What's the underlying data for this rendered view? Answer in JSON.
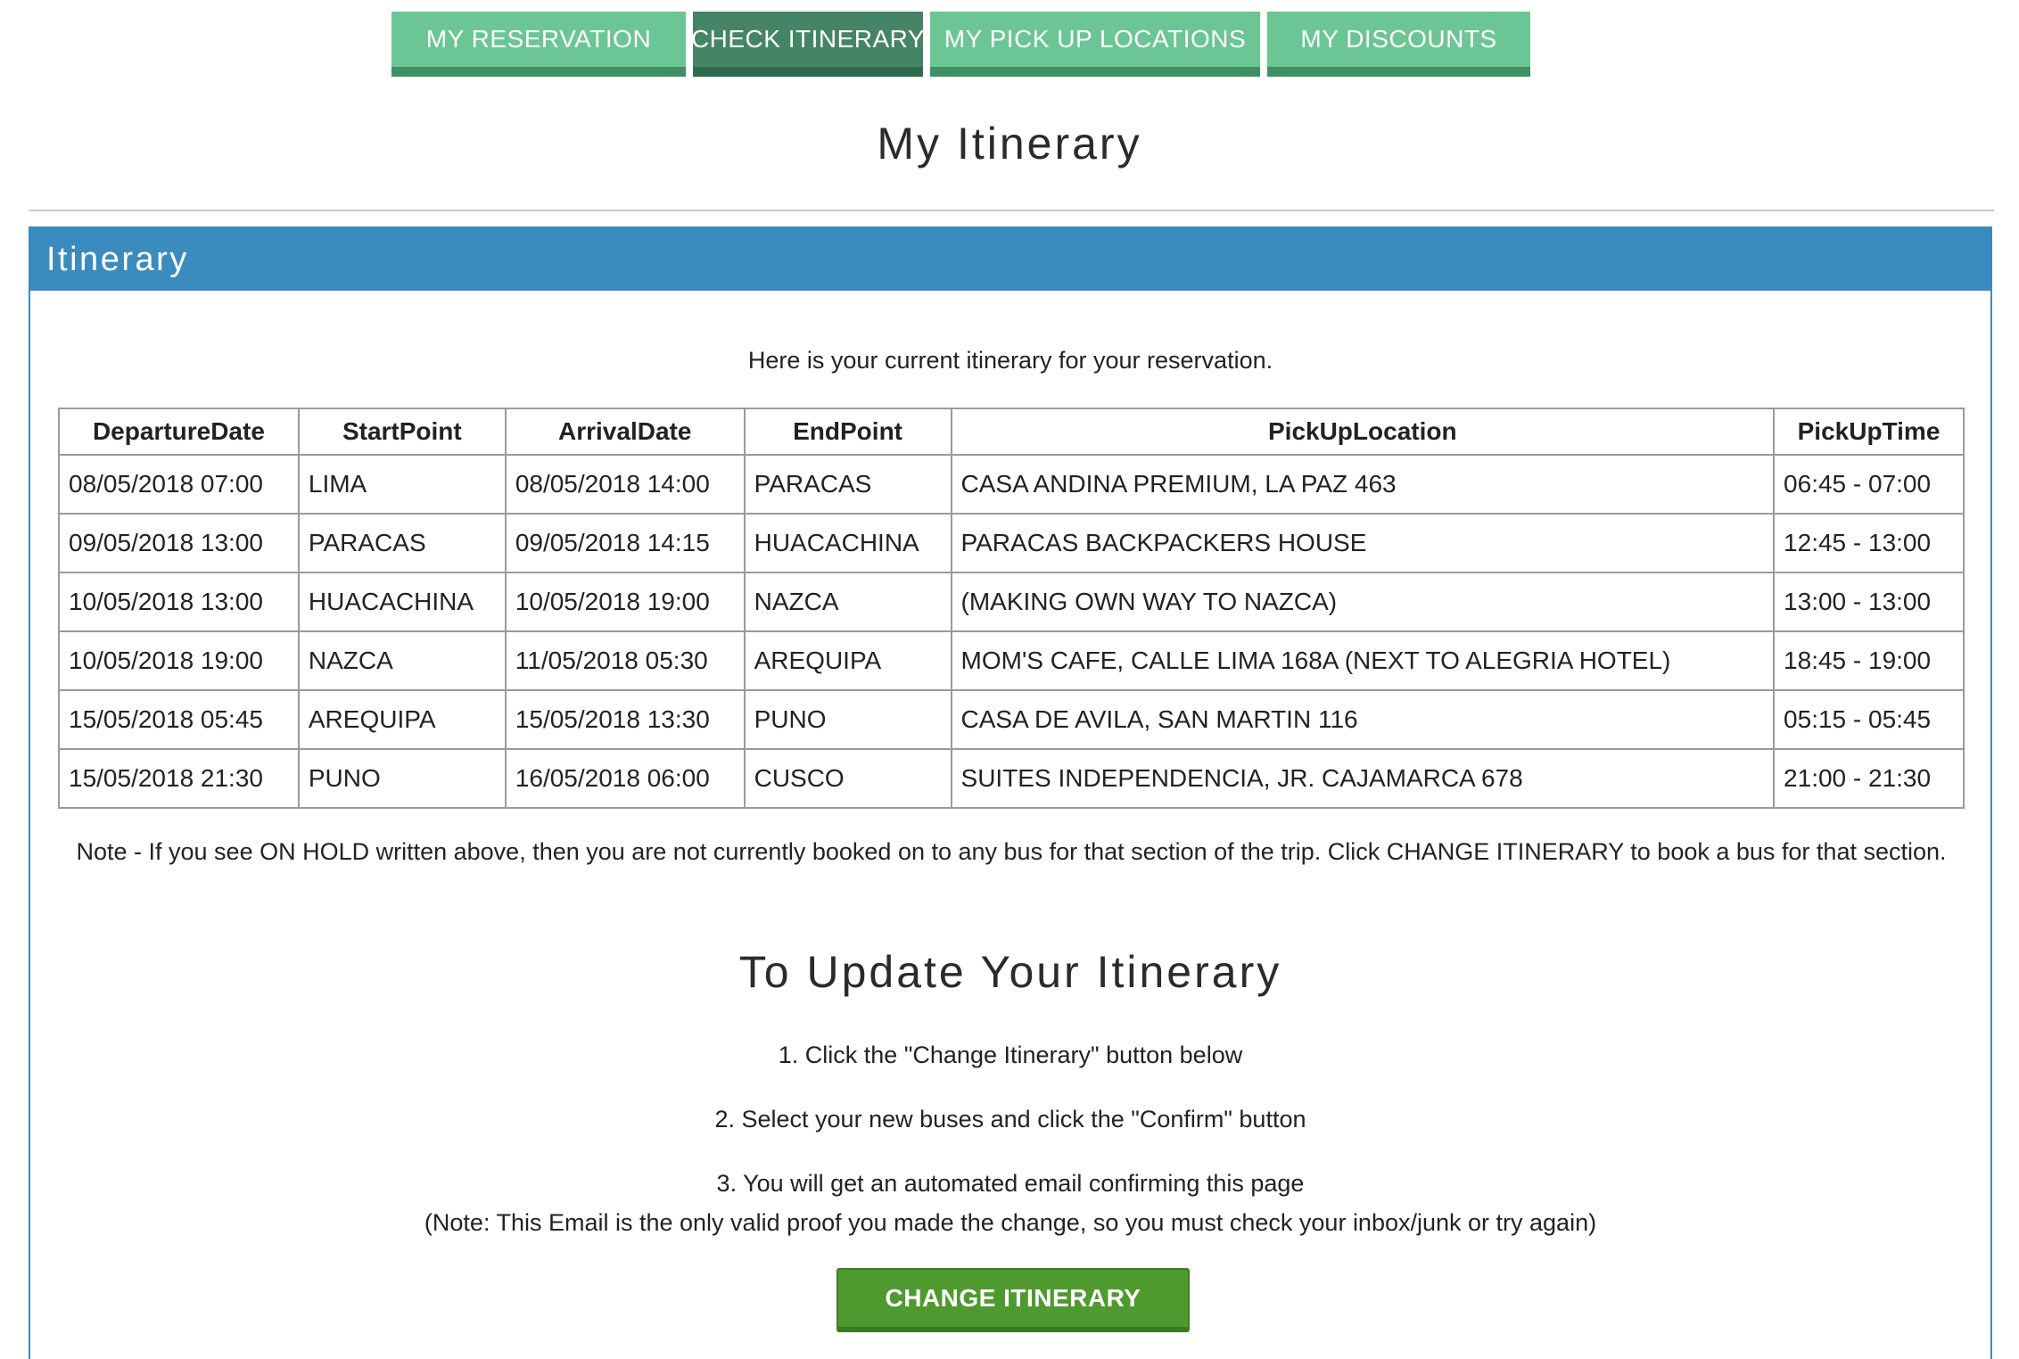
{
  "tabs": [
    {
      "label": "MY RESERVATION"
    },
    {
      "label": "CHECK ITINERARY"
    },
    {
      "label": "MY PICK UP LOCATIONS"
    },
    {
      "label": "MY DISCOUNTS"
    }
  ],
  "page_title": "My Itinerary",
  "panel": {
    "title": "Itinerary",
    "intro": "Here is your current itinerary for your reservation.",
    "columns": [
      "DepartureDate",
      "StartPoint",
      "ArrivalDate",
      "EndPoint",
      "PickUpLocation",
      "PickUpTime"
    ],
    "rows": [
      [
        "08/05/2018 07:00",
        "LIMA",
        "08/05/2018 14:00",
        "PARACAS",
        "CASA ANDINA PREMIUM, LA PAZ 463",
        "06:45 - 07:00"
      ],
      [
        "09/05/2018 13:00",
        "PARACAS",
        "09/05/2018 14:15",
        "HUACACHINA",
        "PARACAS BACKPACKERS HOUSE",
        "12:45 - 13:00"
      ],
      [
        "10/05/2018 13:00",
        "HUACACHINA",
        "10/05/2018 19:00",
        "NAZCA",
        "(MAKING OWN WAY TO NAZCA)",
        "13:00 - 13:00"
      ],
      [
        "10/05/2018 19:00",
        "NAZCA",
        "11/05/2018 05:30",
        "AREQUIPA",
        "MOM'S CAFE, CALLE LIMA 168A (NEXT TO ALEGRIA HOTEL)",
        "18:45 - 19:00"
      ],
      [
        "15/05/2018 05:45",
        "AREQUIPA",
        "15/05/2018 13:30",
        "PUNO",
        "CASA DE AVILA, SAN MARTIN 116",
        "05:15 - 05:45"
      ],
      [
        "15/05/2018 21:30",
        "PUNO",
        "16/05/2018 06:00",
        "CUSCO",
        "SUITES INDEPENDENCIA, JR. CAJAMARCA 678",
        "21:00 - 21:30"
      ]
    ],
    "note": "Note - If you see ON HOLD written above, then you are not currently booked on to any bus for that section of the trip. Click CHANGE ITINERARY to book a bus for that section.",
    "update_title": "To Update Your Itinerary",
    "steps": [
      "1. Click the \"Change Itinerary\" button below",
      "2. Select your new buses and click the \"Confirm\" button",
      "3. You will get an automated email confirming this page",
      "(Note: This Email is the only valid proof you made the change, so you must check your inbox/junk or try again)"
    ],
    "button_label": "CHANGE ITINERARY"
  },
  "colors": {
    "tab": "#6cc594",
    "tab_active": "#468466",
    "panel_header": "#3b8bbe",
    "button": "#4f9a2e"
  }
}
